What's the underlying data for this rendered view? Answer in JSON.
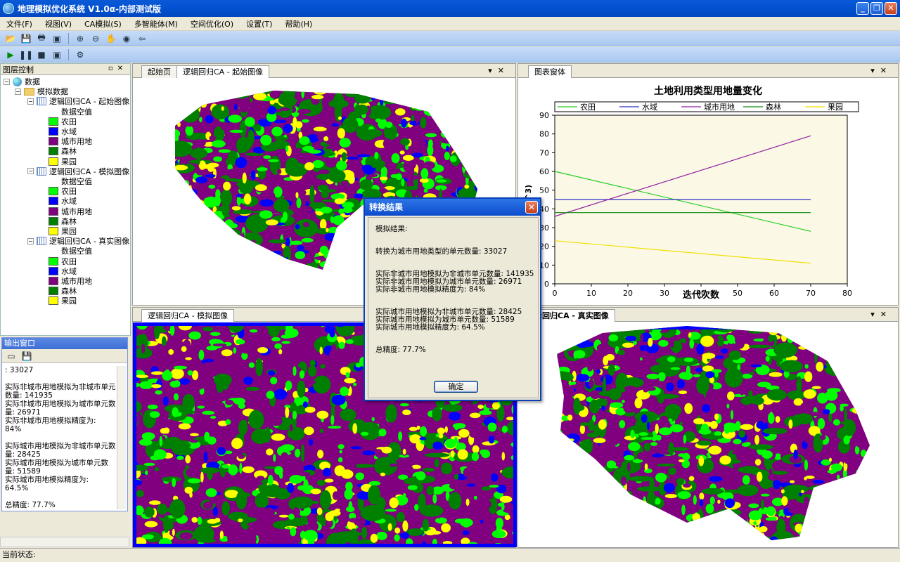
{
  "window": {
    "title": "地理模拟优化系统 V1.0α-内部测试版"
  },
  "menu": [
    "文件(F)",
    "视图(V)",
    "CA模拟(S)",
    "多智能体(M)",
    "空间优化(O)",
    "设置(T)",
    "帮助(H)"
  ],
  "layer_panel": {
    "title": "图层控制",
    "root": "数据",
    "folder": "模拟数据",
    "groups": [
      {
        "name": "逻辑回归CA - 起始图像"
      },
      {
        "name": "逻辑回归CA - 模拟图像"
      },
      {
        "name": "逻辑回归CA - 真实图像"
      }
    ],
    "classes": [
      {
        "label": "数据空值",
        "color": "#ffffff"
      },
      {
        "label": "农田",
        "color": "#00ff00"
      },
      {
        "label": "水域",
        "color": "#0000ff"
      },
      {
        "label": "城市用地",
        "color": "#800080"
      },
      {
        "label": "森林",
        "color": "#008000"
      },
      {
        "label": "果园",
        "color": "#ffff00"
      }
    ]
  },
  "output_panel": {
    "title": "输出窗口",
    "text": ": 33027\n\n实际非城市用地模拟为非城市单元数量: 141935\n实际非城市用地模拟为城市单元数量: 26971\n实际非城市用地模拟精度为:\n84%\n\n实际城市用地模拟为非城市单元数量: 28425\n实际城市用地模拟为城市单元数量: 51589\n实际城市用地模拟精度为:\n64.5%\n\n总精度: 77.7%"
  },
  "status": {
    "label": "当前状态:"
  },
  "tabs": {
    "top_left": [
      "起始页",
      "逻辑回归CA - 起始图像"
    ],
    "top_right": [
      "图表窗体"
    ],
    "bottom_left": [
      "逻辑回归CA - 模拟图像"
    ],
    "bottom_right": [
      "辑回归CA - 真实图像"
    ]
  },
  "dialog": {
    "title": "转换结果",
    "lines": [
      "模拟结果:",
      "转换为城市用地类型的单元数量: 33027",
      "实际非城市用地模拟为非城市单元数量: 141935",
      "实际非城市用地模拟为城市单元数量: 26971",
      "实际非城市用地模拟精度为: 84%",
      "实际城市用地模拟为非城市单元数量: 28425",
      "实际城市用地模拟为城市单元数量: 51589",
      "实际城市用地模拟精度为: 64.5%",
      "总精度: 77.7%"
    ],
    "ok": "确定"
  },
  "chart_data": {
    "type": "line",
    "title": "土地利用类型用地量变化",
    "xlabel": "迭代次数",
    "ylabel": "(10^3)",
    "xlim": [
      0,
      80
    ],
    "ylim": [
      0,
      90
    ],
    "xticks": [
      0,
      10,
      20,
      30,
      40,
      50,
      60,
      70,
      80
    ],
    "yticks": [
      0,
      10,
      20,
      30,
      40,
      50,
      60,
      70,
      80,
      90
    ],
    "legend_position": "top",
    "series": [
      {
        "name": "农田",
        "color": "#22cc22",
        "x": [
          0,
          70
        ],
        "y": [
          60,
          28
        ]
      },
      {
        "name": "水域",
        "color": "#3030c8",
        "x": [
          0,
          70
        ],
        "y": [
          45,
          45
        ]
      },
      {
        "name": "城市用地",
        "color": "#9020a0",
        "x": [
          0,
          70
        ],
        "y": [
          36,
          79
        ]
      },
      {
        "name": "森林",
        "color": "#108a10",
        "x": [
          0,
          70
        ],
        "y": [
          38,
          38
        ]
      },
      {
        "name": "果园",
        "color": "#f0e000",
        "x": [
          0,
          70
        ],
        "y": [
          23,
          11
        ]
      }
    ]
  }
}
